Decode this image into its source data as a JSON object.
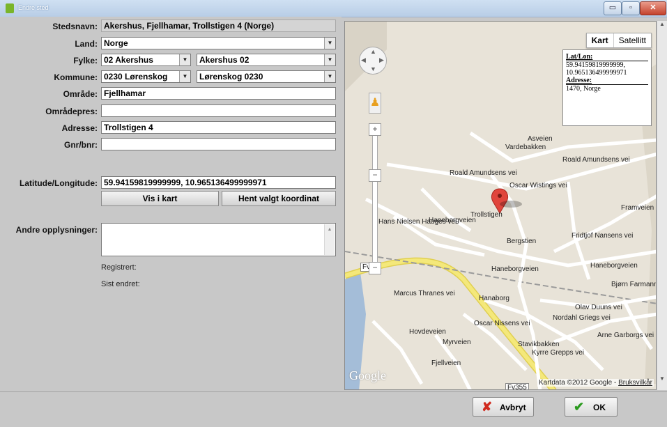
{
  "window": {
    "title": "Endre sted",
    "minimize_glyph": "▭",
    "maximize_glyph": "▫",
    "close_glyph": "✕"
  },
  "form": {
    "stedsnavn_label": "Stedsnavn:",
    "stedsnavn_value": "Akershus, Fjellhamar, Trollstigen 4 (Norge)",
    "land_label": "Land:",
    "land_value": "Norge",
    "fylke_label": "Fylke:",
    "fylke_code": "02  Akershus",
    "fylke_name": "Akershus  02",
    "kommune_label": "Kommune:",
    "kommune_code": "0230  Lørenskog",
    "kommune_name": "Lørenskog  0230",
    "omrade_label": "Område:",
    "omrade_value": "Fjellhamar",
    "omradepres_label": "Områdepres:",
    "omradepres_value": "",
    "adresse_label": "Adresse:",
    "adresse_value": "Trollstigen 4",
    "gnrbnr_label": "Gnr/bnr:",
    "gnrbnr_value": "",
    "latlon_label": "Latitude/Longitude:",
    "latlon_value": "59.94159819999999, 10.965136499999971",
    "vis_i_kart_label": "Vis i kart",
    "hent_label": "Hent valgt koordinat",
    "andre_label": "Andre opplysninger:",
    "andre_value": "",
    "registrert_label": "Registrert:",
    "sist_endret_label": "Sist endret:",
    "dropdown_arrow": "▼"
  },
  "map": {
    "type_kart": "Kart",
    "type_satellitt": "Satellitt",
    "info_latlon_header": "Lat/Lon:",
    "info_lat": "59.94159819999999,",
    "info_lon": "10.965136499999971",
    "info_adresse_header": "Adresse:",
    "info_adresse": "1470, Norge",
    "attribution": "Kartdata ©2012 Google - ",
    "attribution_link": "Bruksvilkår",
    "google_logo": "Google",
    "zoom_plus": "+",
    "zoom_minus": "−",
    "roads": {
      "asveien": "Asveien",
      "roald1": "Roald Amundsens vei",
      "roald2": "Roald Amundsens vei",
      "vardebakken": "Vardebakken",
      "haneborgveien1": "Haneborgveien",
      "haneborgveien2": "Haneborgveien",
      "haneborgveien3": "Haneborgveien",
      "hans_nielsen": "Hans Nielsen Hauges vei",
      "trollstigen": "Trollstigen",
      "oscar_wistings": "Oscar Wistings vei",
      "marcus": "Marcus Thranes vei",
      "hanaborg": "Hanaborg",
      "bergstien": "Bergstien",
      "fridtjof": "Fridtjof Nansens vei",
      "bjorn": "Bjørn Farmann",
      "olav": "Olav Duuns vei",
      "oscar_nissens": "Oscar Nissens vei",
      "nordahl": "Nordahl Griegs vei",
      "arne": "Arne Garborgs vei",
      "myrveien": "Myrveien",
      "fjellveien": "Fjellveien",
      "hovdeveien": "Hovdeveien",
      "stavikbakken": "Stavikbakken",
      "kyrre": "Kyrre Grepps vei",
      "framveien": "Framveien",
      "fv": "Fv",
      "fv355": "Fv355"
    }
  },
  "buttons": {
    "avbryt": "Avbryt",
    "ok": "OK"
  },
  "colors": {
    "map_bg": "#e8e3d8",
    "main_road": "#f4e87a",
    "water": "#a4bdd8",
    "pin": "#e0453c",
    "rail": "#9a9a9a"
  }
}
